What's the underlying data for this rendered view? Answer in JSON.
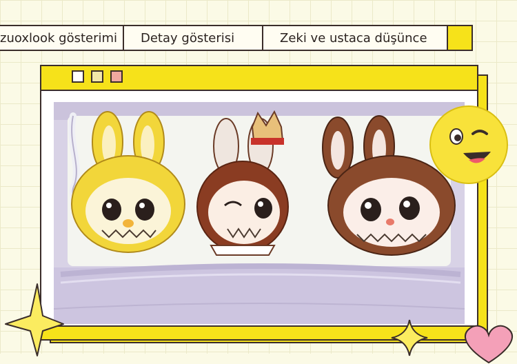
{
  "tabs": [
    {
      "label": "zuoxlook gösterimi"
    },
    {
      "label": "Detay gösterisi"
    },
    {
      "label": "Zeki ve ustaca düşünce"
    }
  ],
  "window": {
    "buttons": [
      "white-square",
      "beige-square",
      "pink-square"
    ]
  },
  "colors": {
    "accent_yellow": "#f6e21a",
    "background": "#fbfae6",
    "border": "#3a2d2a",
    "bag_purple": "#cfc8e0"
  },
  "photo": {
    "icon": "backpack-with-cartoon-characters"
  },
  "stickers": [
    "smiling-emoji-icon",
    "star-icon",
    "sparkle-icon",
    "heart-icon"
  ]
}
